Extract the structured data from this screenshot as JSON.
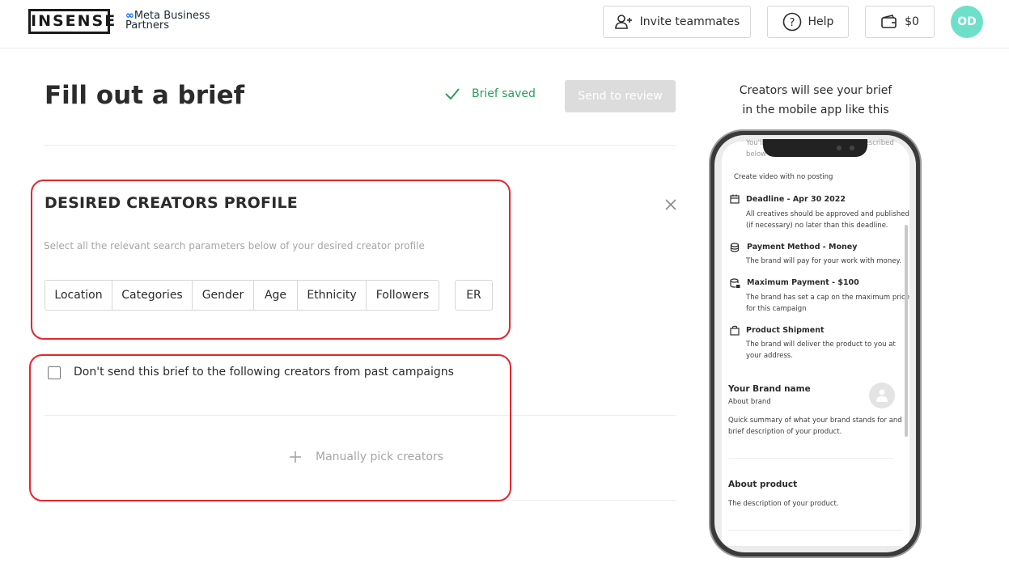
{
  "header": {
    "logo_text": "INSENSE",
    "partner_line1": "Meta Business",
    "partner_line2": "Partners",
    "invite_label": "Invite teammates",
    "help_label": "Help",
    "balance": "$0",
    "avatar_initials": "OD"
  },
  "title_row": {
    "title": "Fill out a brief",
    "saved_status": "Brief saved",
    "send_review_label": "Send to review"
  },
  "creators_profile": {
    "title": "DESIRED CREATORS PROFILE",
    "subtitle": "Select all the relevant search parameters below of your desired creator profile",
    "filters": [
      "Location",
      "Categories",
      "Gender",
      "Age",
      "Ethnicity",
      "Followers"
    ],
    "er_label": "ER"
  },
  "exclude_section": {
    "checkbox_label": "Don't send this brief to the following creators from past campaigns",
    "checked": false,
    "pick_label": "Manually pick creators"
  },
  "preview": {
    "caption_line1": "Creators will see your brief",
    "caption_line2": "in the mobile app like this",
    "top_partial_1": "You'll need to create the content described",
    "top_partial_2": "below for TikTok",
    "posting_note": "Create video with no posting",
    "deadline_title": "Deadline - Apr 30 2022",
    "deadline_text_1": "All creatives should be approved and published",
    "deadline_text_2": "(if necessary) no later than this deadline.",
    "payment_method_title": "Payment Method - Money",
    "payment_method_text": "The brand will pay for your work with money.",
    "max_payment_title": "Maximum Payment - $100",
    "max_payment_text_1": "The brand has set a cap on the maximum price",
    "max_payment_text_2": "for this campaign",
    "shipment_title": "Product Shipment",
    "shipment_text_1": "The brand will deliver the product to you at",
    "shipment_text_2": "your address.",
    "brand_name": "Your Brand name",
    "about_brand": "About brand",
    "brand_summary_1": "Quick summary of what your brand stands for and a",
    "brand_summary_2": "brief description of your product.",
    "about_product_title": "About product",
    "about_product_text": "The description of your product."
  },
  "colors": {
    "accent_green": "#27a05a",
    "highlight_red": "#e3262d",
    "avatar_bg": "#6ee0c9",
    "disabled_button": "#dcdcdc"
  }
}
